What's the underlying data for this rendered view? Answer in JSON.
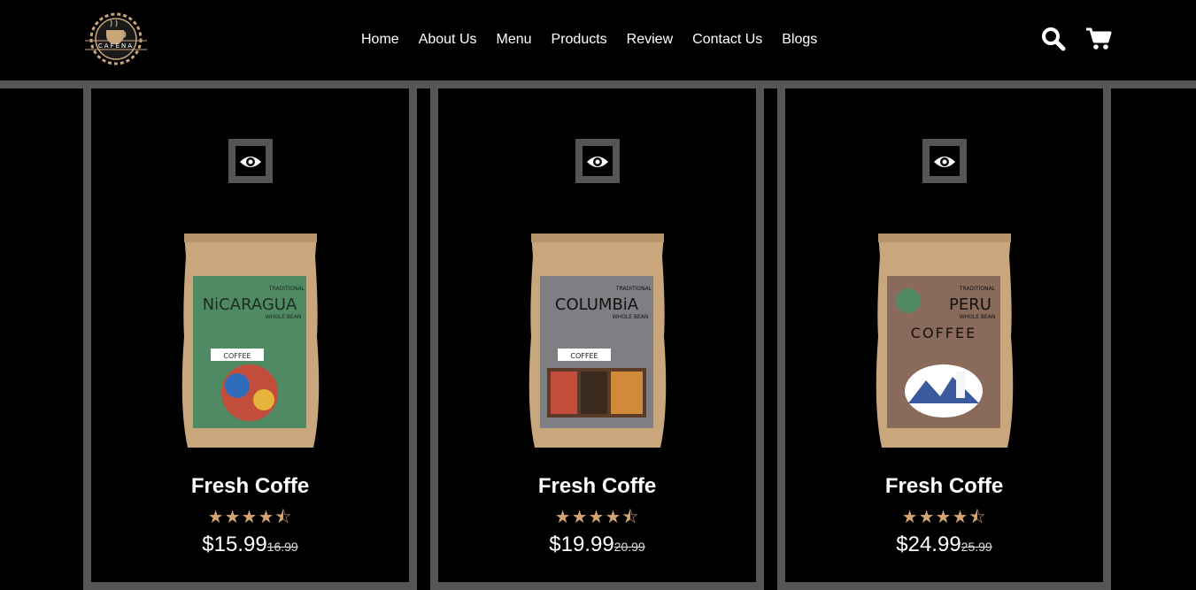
{
  "brand": {
    "logo_text": "CAFENA"
  },
  "nav": {
    "items": [
      {
        "label": "Home"
      },
      {
        "label": "About Us"
      },
      {
        "label": "Menu"
      },
      {
        "label": "Products"
      },
      {
        "label": "Review"
      },
      {
        "label": "Contact Us"
      },
      {
        "label": "Blogs"
      }
    ]
  },
  "header_icons": {
    "search": "search-icon",
    "cart": "cart-icon"
  },
  "colors": {
    "background": "#000000",
    "border": "#555555",
    "star": "#d4a373"
  },
  "products": [
    {
      "name": "Fresh Coffe",
      "price": "$15.99",
      "old_price": "16.99",
      "rating": 4.5,
      "stars": "★★★★⯪",
      "bag_color": "#4f8a63",
      "bag_label": "NiCARAGUA",
      "bag_sub": "WHOLE BEAN",
      "bag_top": "TRADITIONAL",
      "bag_badge": "COFFEE"
    },
    {
      "name": "Fresh Coffe",
      "price": "$19.99",
      "old_price": "20.99",
      "rating": 4.5,
      "stars": "★★★★⯪",
      "bag_color": "#7d7f82",
      "bag_label": "COLUMBiA",
      "bag_sub": "WHOLE BEAN",
      "bag_top": "TRADITIONAL",
      "bag_badge": "COFFEE"
    },
    {
      "name": "Fresh Coffe",
      "price": "$24.99",
      "old_price": "25.99",
      "rating": 4.5,
      "stars": "★★★★⯪",
      "bag_color": "#8a6a5a",
      "bag_label": "PERU",
      "bag_sub": "WHOLE BEAN",
      "bag_top": "TRADITIONAL",
      "bag_badge": "COFFEE"
    }
  ]
}
